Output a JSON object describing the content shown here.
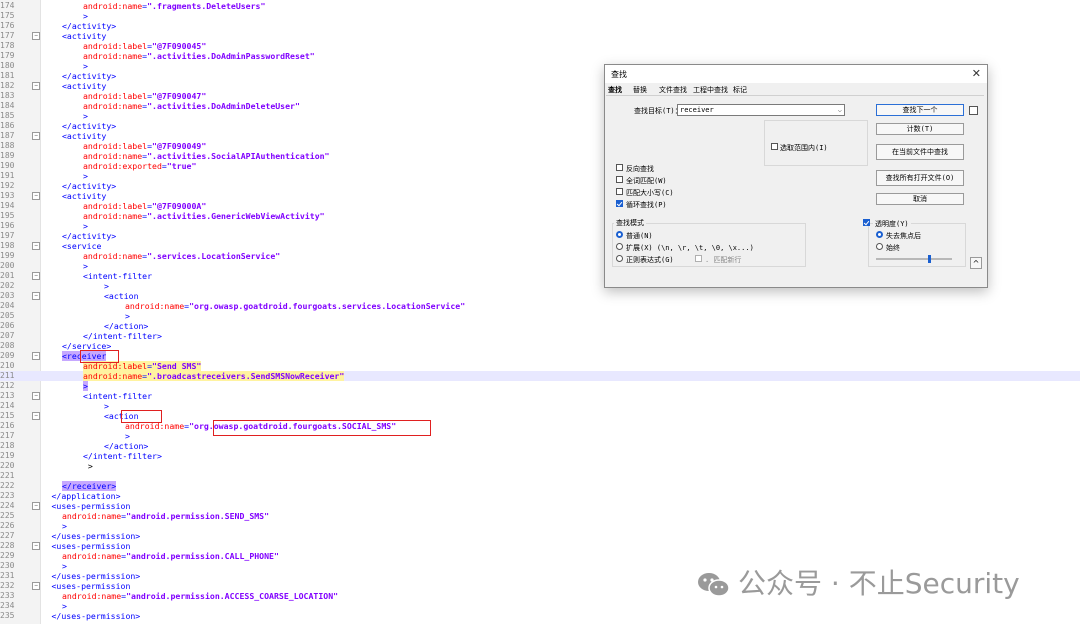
{
  "editor": {
    "lines": [
      {
        "no": "174",
        "indent": 4,
        "tokens": [
          {
            "c": "attr",
            "t": "android:name"
          },
          {
            "c": "sym",
            "t": "="
          },
          {
            "c": "val",
            "t": "\".fragments.DeleteUsers\""
          }
        ]
      },
      {
        "no": "175",
        "indent": 4,
        "tokens": [
          {
            "c": "sym",
            "t": ">"
          }
        ]
      },
      {
        "no": "176",
        "indent": 2,
        "tokens": [
          {
            "c": "tag",
            "t": "</activity>"
          }
        ]
      },
      {
        "no": "177",
        "indent": 2,
        "fold": true,
        "tokens": [
          {
            "c": "tag",
            "t": "<activity"
          }
        ]
      },
      {
        "no": "178",
        "indent": 4,
        "tokens": [
          {
            "c": "attr",
            "t": "android:label"
          },
          {
            "c": "sym",
            "t": "="
          },
          {
            "c": "val",
            "t": "\"@7F090045\""
          }
        ]
      },
      {
        "no": "179",
        "indent": 4,
        "tokens": [
          {
            "c": "attr",
            "t": "android:name"
          },
          {
            "c": "sym",
            "t": "="
          },
          {
            "c": "val",
            "t": "\".activities.DoAdminPasswordReset\""
          }
        ]
      },
      {
        "no": "180",
        "indent": 4,
        "tokens": [
          {
            "c": "sym",
            "t": ">"
          }
        ]
      },
      {
        "no": "181",
        "indent": 2,
        "tokens": [
          {
            "c": "tag",
            "t": "</activity>"
          }
        ]
      },
      {
        "no": "182",
        "indent": 2,
        "fold": true,
        "tokens": [
          {
            "c": "tag",
            "t": "<activity"
          }
        ]
      },
      {
        "no": "183",
        "indent": 4,
        "tokens": [
          {
            "c": "attr",
            "t": "android:label"
          },
          {
            "c": "sym",
            "t": "="
          },
          {
            "c": "val",
            "t": "\"@7F090047\""
          }
        ]
      },
      {
        "no": "184",
        "indent": 4,
        "tokens": [
          {
            "c": "attr",
            "t": "android:name"
          },
          {
            "c": "sym",
            "t": "="
          },
          {
            "c": "val",
            "t": "\".activities.DoAdminDeleteUser\""
          }
        ]
      },
      {
        "no": "185",
        "indent": 4,
        "tokens": [
          {
            "c": "sym",
            "t": ">"
          }
        ]
      },
      {
        "no": "186",
        "indent": 2,
        "tokens": [
          {
            "c": "tag",
            "t": "</activity>"
          }
        ]
      },
      {
        "no": "187",
        "indent": 2,
        "fold": true,
        "tokens": [
          {
            "c": "tag",
            "t": "<activity"
          }
        ]
      },
      {
        "no": "188",
        "indent": 4,
        "tokens": [
          {
            "c": "attr",
            "t": "android:label"
          },
          {
            "c": "sym",
            "t": "="
          },
          {
            "c": "val",
            "t": "\"@7F090049\""
          }
        ]
      },
      {
        "no": "189",
        "indent": 4,
        "tokens": [
          {
            "c": "attr",
            "t": "android:name"
          },
          {
            "c": "sym",
            "t": "="
          },
          {
            "c": "val",
            "t": "\".activities.SocialAPIAuthentication\""
          }
        ]
      },
      {
        "no": "190",
        "indent": 4,
        "tokens": [
          {
            "c": "attr",
            "t": "android:exported"
          },
          {
            "c": "sym",
            "t": "="
          },
          {
            "c": "val",
            "t": "\"true\""
          }
        ]
      },
      {
        "no": "191",
        "indent": 4,
        "tokens": [
          {
            "c": "sym",
            "t": ">"
          }
        ]
      },
      {
        "no": "192",
        "indent": 2,
        "tokens": [
          {
            "c": "tag",
            "t": "</activity>"
          }
        ]
      },
      {
        "no": "193",
        "indent": 2,
        "fold": true,
        "tokens": [
          {
            "c": "tag",
            "t": "<activity"
          }
        ]
      },
      {
        "no": "194",
        "indent": 4,
        "tokens": [
          {
            "c": "attr",
            "t": "android:label"
          },
          {
            "c": "sym",
            "t": "="
          },
          {
            "c": "val",
            "t": "\"@7F09000A\""
          }
        ]
      },
      {
        "no": "195",
        "indent": 4,
        "tokens": [
          {
            "c": "attr",
            "t": "android:name"
          },
          {
            "c": "sym",
            "t": "="
          },
          {
            "c": "val",
            "t": "\".activities.GenericWebViewActivity\""
          }
        ]
      },
      {
        "no": "196",
        "indent": 4,
        "tokens": [
          {
            "c": "sym",
            "t": ">"
          }
        ]
      },
      {
        "no": "197",
        "indent": 2,
        "tokens": [
          {
            "c": "tag",
            "t": "</activity>"
          }
        ]
      },
      {
        "no": "198",
        "indent": 2,
        "fold": true,
        "tokens": [
          {
            "c": "tag",
            "t": "<service"
          }
        ]
      },
      {
        "no": "199",
        "indent": 4,
        "tokens": [
          {
            "c": "attr",
            "t": "android:name"
          },
          {
            "c": "sym",
            "t": "="
          },
          {
            "c": "val",
            "t": "\".services.LocationService\""
          }
        ]
      },
      {
        "no": "200",
        "indent": 4,
        "tokens": [
          {
            "c": "sym",
            "t": ">"
          }
        ]
      },
      {
        "no": "201",
        "indent": 4,
        "fold": true,
        "tokens": [
          {
            "c": "tag",
            "t": "<intent-filter"
          }
        ]
      },
      {
        "no": "202",
        "indent": 6,
        "tokens": [
          {
            "c": "sym",
            "t": ">"
          }
        ]
      },
      {
        "no": "203",
        "indent": 6,
        "fold": true,
        "tokens": [
          {
            "c": "tag",
            "t": "<action"
          }
        ]
      },
      {
        "no": "204",
        "indent": 8,
        "tokens": [
          {
            "c": "attr",
            "t": "android:name"
          },
          {
            "c": "sym",
            "t": "="
          },
          {
            "c": "val",
            "t": "\"org.owasp.goatdroid.fourgoats.services.LocationService\""
          }
        ]
      },
      {
        "no": "205",
        "indent": 8,
        "tokens": [
          {
            "c": "sym",
            "t": ">"
          }
        ]
      },
      {
        "no": "206",
        "indent": 6,
        "tokens": [
          {
            "c": "tag",
            "t": "</action>"
          }
        ]
      },
      {
        "no": "207",
        "indent": 4,
        "tokens": [
          {
            "c": "tag",
            "t": "</intent-filter>"
          }
        ]
      },
      {
        "no": "208",
        "indent": 2,
        "tokens": [
          {
            "c": "tag",
            "t": "</service>"
          }
        ]
      },
      {
        "no": "209",
        "indent": 2,
        "fold": true,
        "tokens": [
          {
            "c": "tag",
            "t": "<receiver",
            "m": "p"
          }
        ]
      },
      {
        "no": "210",
        "indent": 4,
        "tokens": [
          {
            "c": "attr",
            "t": "android:label",
            "m": "y"
          },
          {
            "c": "sym",
            "t": "=",
            "m": "y"
          },
          {
            "c": "val",
            "t": "\"Send SMS\"",
            "m": "y"
          }
        ]
      },
      {
        "no": "211",
        "indent": 4,
        "hl": true,
        "tokens": [
          {
            "c": "attr",
            "t": "android:name",
            "m": "y"
          },
          {
            "c": "sym",
            "t": "=",
            "m": "y"
          },
          {
            "c": "val",
            "t": "\".broadcast",
            "m": "y"
          },
          {
            "c": "val",
            "t": "receiver",
            "m": "y"
          },
          {
            "c": "val",
            "t": "s.SendSMSNowReceiver\"",
            "m": "y"
          }
        ]
      },
      {
        "no": "212",
        "indent": 4,
        "tokens": [
          {
            "c": "sym",
            "t": ">",
            "m": "p"
          }
        ]
      },
      {
        "no": "213",
        "indent": 4,
        "fold": true,
        "tokens": [
          {
            "c": "tag",
            "t": "<intent-filter"
          }
        ]
      },
      {
        "no": "214",
        "indent": 6,
        "tokens": [
          {
            "c": "sym",
            "t": ">"
          }
        ]
      },
      {
        "no": "215",
        "indent": 6,
        "fold": true,
        "tokens": [
          {
            "c": "tag",
            "t": "<action"
          }
        ]
      },
      {
        "no": "216",
        "indent": 8,
        "tokens": [
          {
            "c": "attr",
            "t": "android:name"
          },
          {
            "c": "sym",
            "t": "="
          },
          {
            "c": "val",
            "t": "\"org.owasp.goatdroid.fourgoats.SOCIAL_SMS\""
          }
        ]
      },
      {
        "no": "217",
        "indent": 8,
        "tokens": [
          {
            "c": "sym",
            "t": ">"
          }
        ]
      },
      {
        "no": "218",
        "indent": 6,
        "tokens": [
          {
            "c": "tag",
            "t": "</action>"
          }
        ]
      },
      {
        "no": "219",
        "indent": 4,
        "tokens": [
          {
            "c": "tag",
            "t": "</intent-filter>"
          }
        ]
      },
      {
        "no": "220",
        "indent": 4,
        "tokens": [
          {
            "c": "plain",
            "t": " >"
          }
        ]
      },
      {
        "no": "221",
        "indent": 0,
        "tokens": []
      },
      {
        "no": "222",
        "indent": 2,
        "tokens": [
          {
            "c": "tag",
            "t": "</receiver>",
            "m": "p"
          }
        ]
      },
      {
        "no": "223",
        "indent": 1,
        "tokens": [
          {
            "c": "tag",
            "t": "</application>"
          }
        ]
      },
      {
        "no": "224",
        "indent": 1,
        "fold": true,
        "tokens": [
          {
            "c": "tag",
            "t": "<uses-permission"
          }
        ]
      },
      {
        "no": "225",
        "indent": 2,
        "tokens": [
          {
            "c": "attr",
            "t": "android:name"
          },
          {
            "c": "sym",
            "t": "="
          },
          {
            "c": "val",
            "t": "\"android.permission.SEND_SMS\""
          }
        ]
      },
      {
        "no": "226",
        "indent": 2,
        "tokens": [
          {
            "c": "sym",
            "t": ">"
          }
        ]
      },
      {
        "no": "227",
        "indent": 1,
        "tokens": [
          {
            "c": "tag",
            "t": "</uses-permission>"
          }
        ]
      },
      {
        "no": "228",
        "indent": 1,
        "fold": true,
        "tokens": [
          {
            "c": "tag",
            "t": "<uses-permission"
          }
        ]
      },
      {
        "no": "229",
        "indent": 2,
        "tokens": [
          {
            "c": "attr",
            "t": "android:name"
          },
          {
            "c": "sym",
            "t": "="
          },
          {
            "c": "val",
            "t": "\"android.permission.CALL_PHONE\""
          }
        ]
      },
      {
        "no": "230",
        "indent": 2,
        "tokens": [
          {
            "c": "sym",
            "t": ">"
          }
        ]
      },
      {
        "no": "231",
        "indent": 1,
        "tokens": [
          {
            "c": "tag",
            "t": "</uses-permission>"
          }
        ]
      },
      {
        "no": "232",
        "indent": 1,
        "fold": true,
        "tokens": [
          {
            "c": "tag",
            "t": "<uses-permission"
          }
        ]
      },
      {
        "no": "233",
        "indent": 2,
        "tokens": [
          {
            "c": "attr",
            "t": "android:name"
          },
          {
            "c": "sym",
            "t": "="
          },
          {
            "c": "val",
            "t": "\"android.permission.ACCESS_COARSE_LOCATION\""
          }
        ]
      },
      {
        "no": "234",
        "indent": 2,
        "tokens": [
          {
            "c": "sym",
            "t": ">"
          }
        ]
      },
      {
        "no": "235",
        "indent": 1,
        "tokens": [
          {
            "c": "tag",
            "t": "</uses-permission>"
          }
        ]
      }
    ]
  },
  "dialog": {
    "title": "查找",
    "close": "✕",
    "tabs": [
      "查找",
      "替换",
      "文件查找",
      "工程中查找",
      "标记"
    ],
    "find_label": "查找目标(T)：",
    "find_value": "receiver",
    "selection_only": "选取范围内(I)",
    "options": {
      "reverse": "反向查找",
      "whole_word": "全词匹配(W)",
      "match_case": "匹配大小写(C)",
      "wrap": "循环查找(P)"
    },
    "mode_title": "查找模式",
    "modes": {
      "normal": "普通(N)",
      "extended": "扩展(X) (\\n, \\r, \\t, \\0, \\x...)",
      "regex": "正则表达式(G)",
      "dot_newline": ". 匹配新行"
    },
    "transparency": {
      "title": "透明度(Y)",
      "on_lose_focus": "失去焦点后",
      "always": "始终"
    },
    "buttons": {
      "find_next": "查找下一个",
      "count": "计数(T)",
      "find_all_current": "在当前文件中查找",
      "find_all_open": "查找所有打开文件(O)",
      "cancel": "取消"
    },
    "collapse": "^"
  },
  "watermark": {
    "text": "公众号 · 不止Security"
  },
  "colors": {
    "tag": "#0000ff",
    "attr": "#ff0000",
    "value": "#8000ff",
    "highlight_box": "#e02020",
    "accent": "#1a5fd0"
  }
}
